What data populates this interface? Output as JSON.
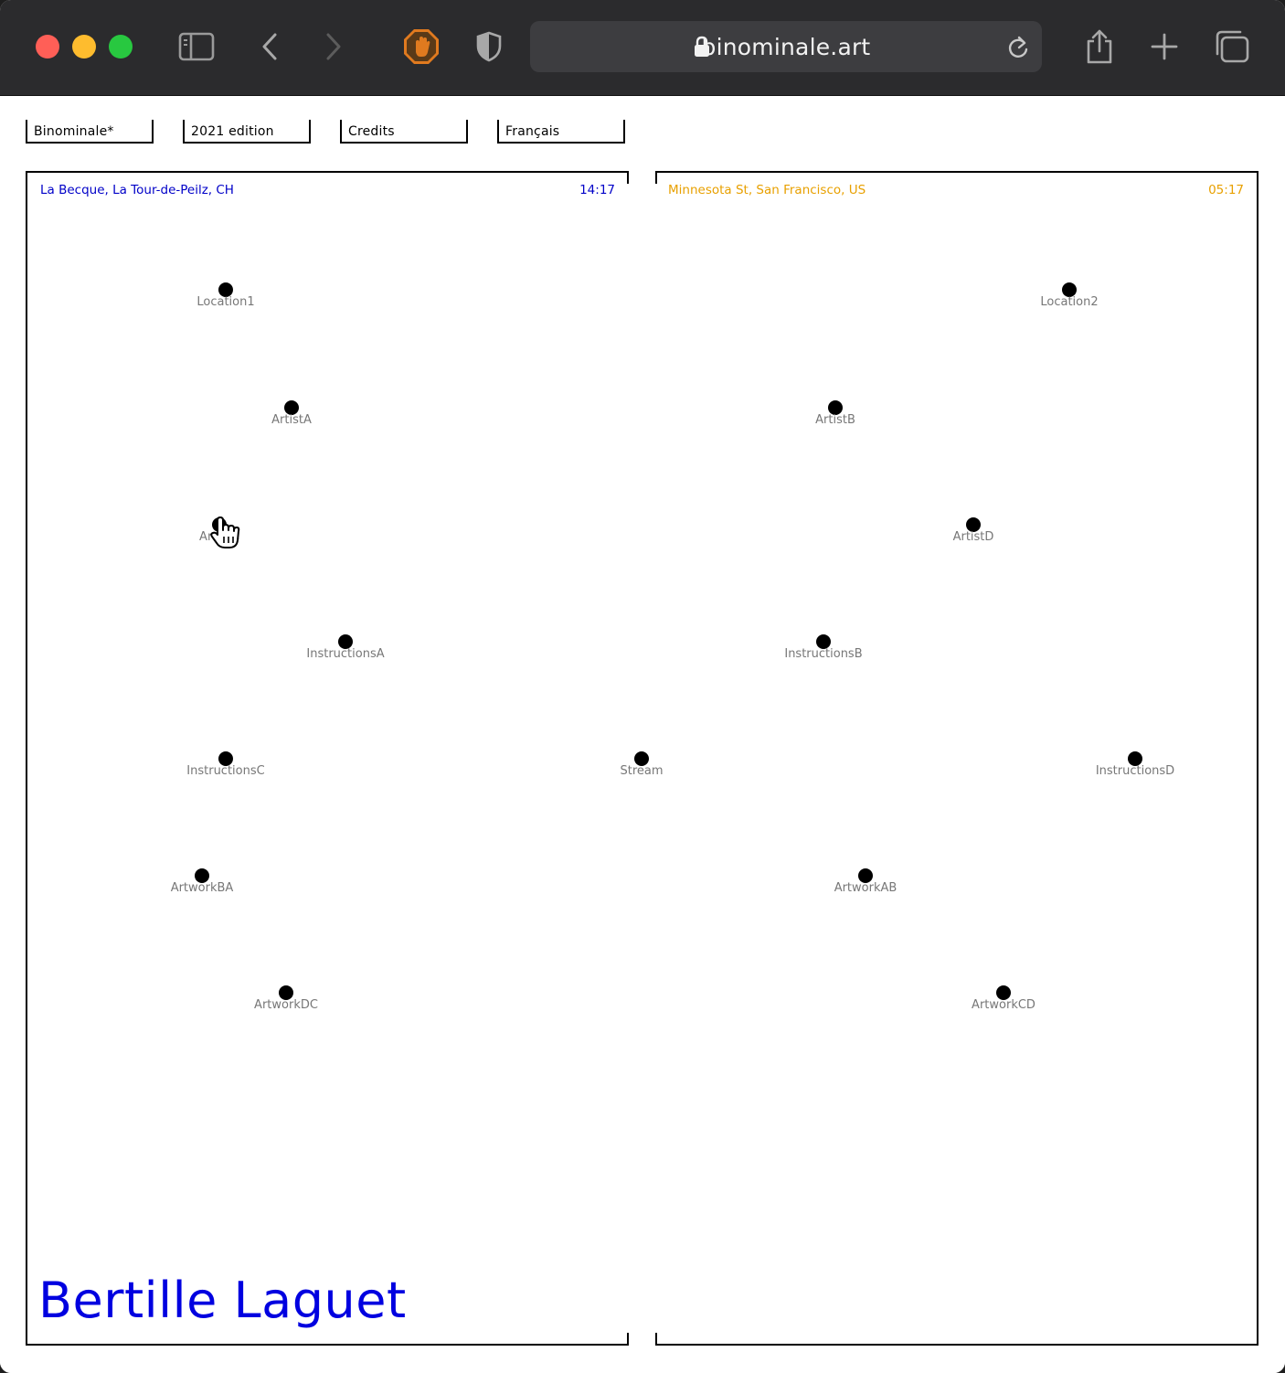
{
  "browser": {
    "url": "binominale.art",
    "icons": [
      "sidebar-icon",
      "back-icon",
      "forward-icon",
      "hand-stop-extension-icon",
      "shield-icon",
      "lock-icon",
      "reload-icon",
      "share-icon",
      "new-tab-icon",
      "tabs-overview-icon"
    ]
  },
  "nav": {
    "items": [
      {
        "label": "Binominale*"
      },
      {
        "label": "2021 edition"
      },
      {
        "label": "Credits"
      },
      {
        "label": "Français"
      }
    ]
  },
  "left_panel": {
    "location": "La Becque, La Tour-de-Peilz, CH",
    "time": "14:17",
    "color": "#0000c8"
  },
  "right_panel": {
    "location": "Minnesota St, San Francisco, US",
    "time": "05:17",
    "color": "#e8a000"
  },
  "artist_name": "Bertille Laguet",
  "nodes": {
    "location1": "Location1",
    "location2": "Location2",
    "artist_a": "ArtistA",
    "artist_b": "ArtistB",
    "artist_c": "ArtistC",
    "artist_d": "ArtistD",
    "instructions_a": "InstructionsA",
    "instructions_b": "InstructionsB",
    "instructions_c": "InstructionsC",
    "instructions_d": "InstructionsD",
    "stream": "Stream",
    "artwork_ba": "ArtworkBA",
    "artwork_ab": "ArtworkAB",
    "artwork_dc": "ArtworkDC",
    "artwork_cd": "ArtworkCD"
  }
}
